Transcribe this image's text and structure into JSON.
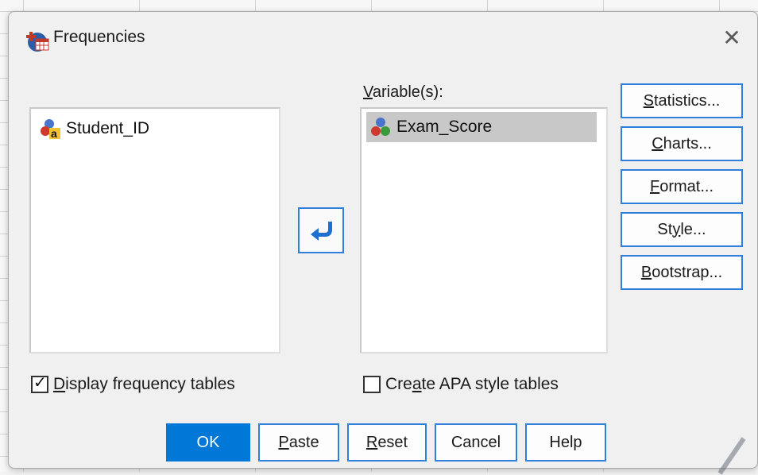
{
  "window": {
    "title": "Frequencies",
    "close_icon": "close-icon",
    "app_icon": "spss-frequencies-icon"
  },
  "source_list": {
    "items": [
      {
        "label": "Student_ID",
        "icon": "string-variable-icon"
      }
    ]
  },
  "target_list": {
    "label_accel": "V",
    "label_rest": "ariable(s):",
    "items": [
      {
        "label": "Exam_Score",
        "icon": "scale-variable-icon",
        "selected": true
      }
    ]
  },
  "move_button": {
    "icon": "move-arrow-icon"
  },
  "side_buttons": {
    "statistics": {
      "accel": "S",
      "rest": "tatistics..."
    },
    "charts": {
      "accel": "C",
      "rest": "harts..."
    },
    "format": {
      "accel": "F",
      "rest": "ormat..."
    },
    "style": {
      "pre": "St",
      "accel": "y",
      "rest": "le..."
    },
    "bootstrap": {
      "accel": "B",
      "rest": "ootstrap..."
    }
  },
  "checkboxes": {
    "display_freq": {
      "accel": "D",
      "rest": "isplay frequency tables",
      "checked": true
    },
    "apa_tables": {
      "pre": "Cre",
      "accel": "a",
      "rest": "te APA style tables",
      "checked": false
    }
  },
  "bottom_buttons": {
    "ok": "OK",
    "paste": {
      "accel": "P",
      "rest": "aste"
    },
    "reset": {
      "accel": "R",
      "rest": "eset"
    },
    "cancel": "Cancel",
    "help": "Help"
  },
  "colors": {
    "accent": "#0078d7",
    "button_border": "#2f7fdc",
    "selection": "#c8c8c8"
  }
}
